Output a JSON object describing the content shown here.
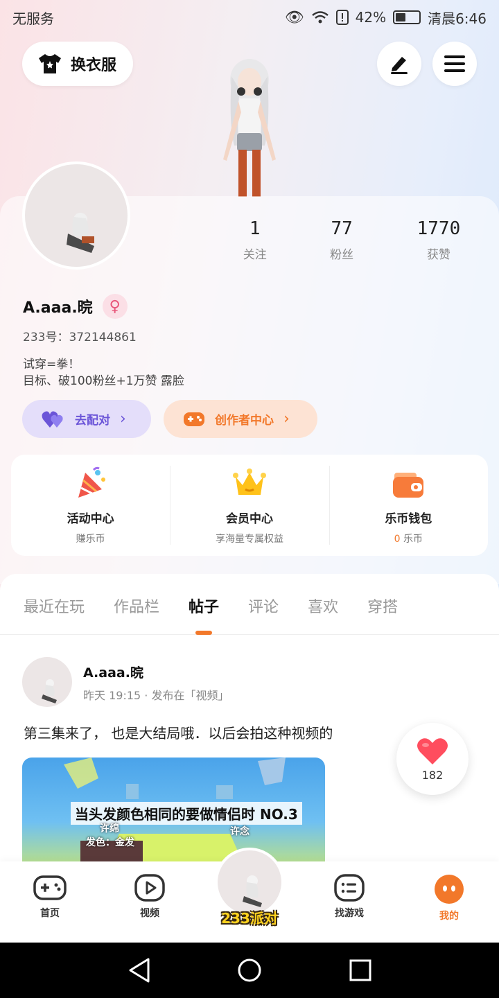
{
  "status_bar": {
    "carrier": "无服务",
    "battery": "42%",
    "time": "清晨6:46"
  },
  "top": {
    "outfit_label": "换衣服",
    "edit_icon": "edit-icon",
    "menu_icon": "menu-icon"
  },
  "profile": {
    "stats": [
      {
        "value": "1",
        "label": "关注"
      },
      {
        "value": "77",
        "label": "粉丝"
      },
      {
        "value": "1770",
        "label": "获赞"
      }
    ],
    "username": "A.aaa.晥",
    "gender_symbol": "♀",
    "user_id": "233号：372144861",
    "bio_line1": "试穿=拳！",
    "bio_line2": "目标、破100粉丝+1万赞 露脸",
    "pair_label": "去配对",
    "creator_label": "创作者中心"
  },
  "features": [
    {
      "title": "活动中心",
      "sub": "赚乐币",
      "icon": "party-popper-icon"
    },
    {
      "title": "会员中心",
      "sub": "享海量专属权益",
      "icon": "crown-icon"
    },
    {
      "title": "乐币钱包",
      "sub_count": "0",
      "sub": "乐币",
      "icon": "wallet-icon"
    }
  ],
  "tabs": [
    "最近在玩",
    "作品栏",
    "帖子",
    "评论",
    "喜欢",
    "穿搭"
  ],
  "active_tab": "帖子",
  "post": {
    "author": "A.aaa.晥",
    "meta": "昨天 19:15 · 发布在「视频」",
    "text": "第三集来了， 也是大结局哦．以后会拍这种视频的",
    "media_caption": "当头发颜色相同的要做情侣时 NO.3",
    "media_sub1": "许绵",
    "media_sub2": "发色：金发",
    "media_sub3": "许念",
    "likes": "182"
  },
  "bottom_nav": {
    "items": [
      "首页",
      "视频",
      "找游戏",
      "我的"
    ],
    "center_label": "233派对",
    "active": "我的"
  },
  "colors": {
    "accent": "#f2782a",
    "pair_purple": "#6b55d8",
    "like_red": "#ff4d5e"
  }
}
